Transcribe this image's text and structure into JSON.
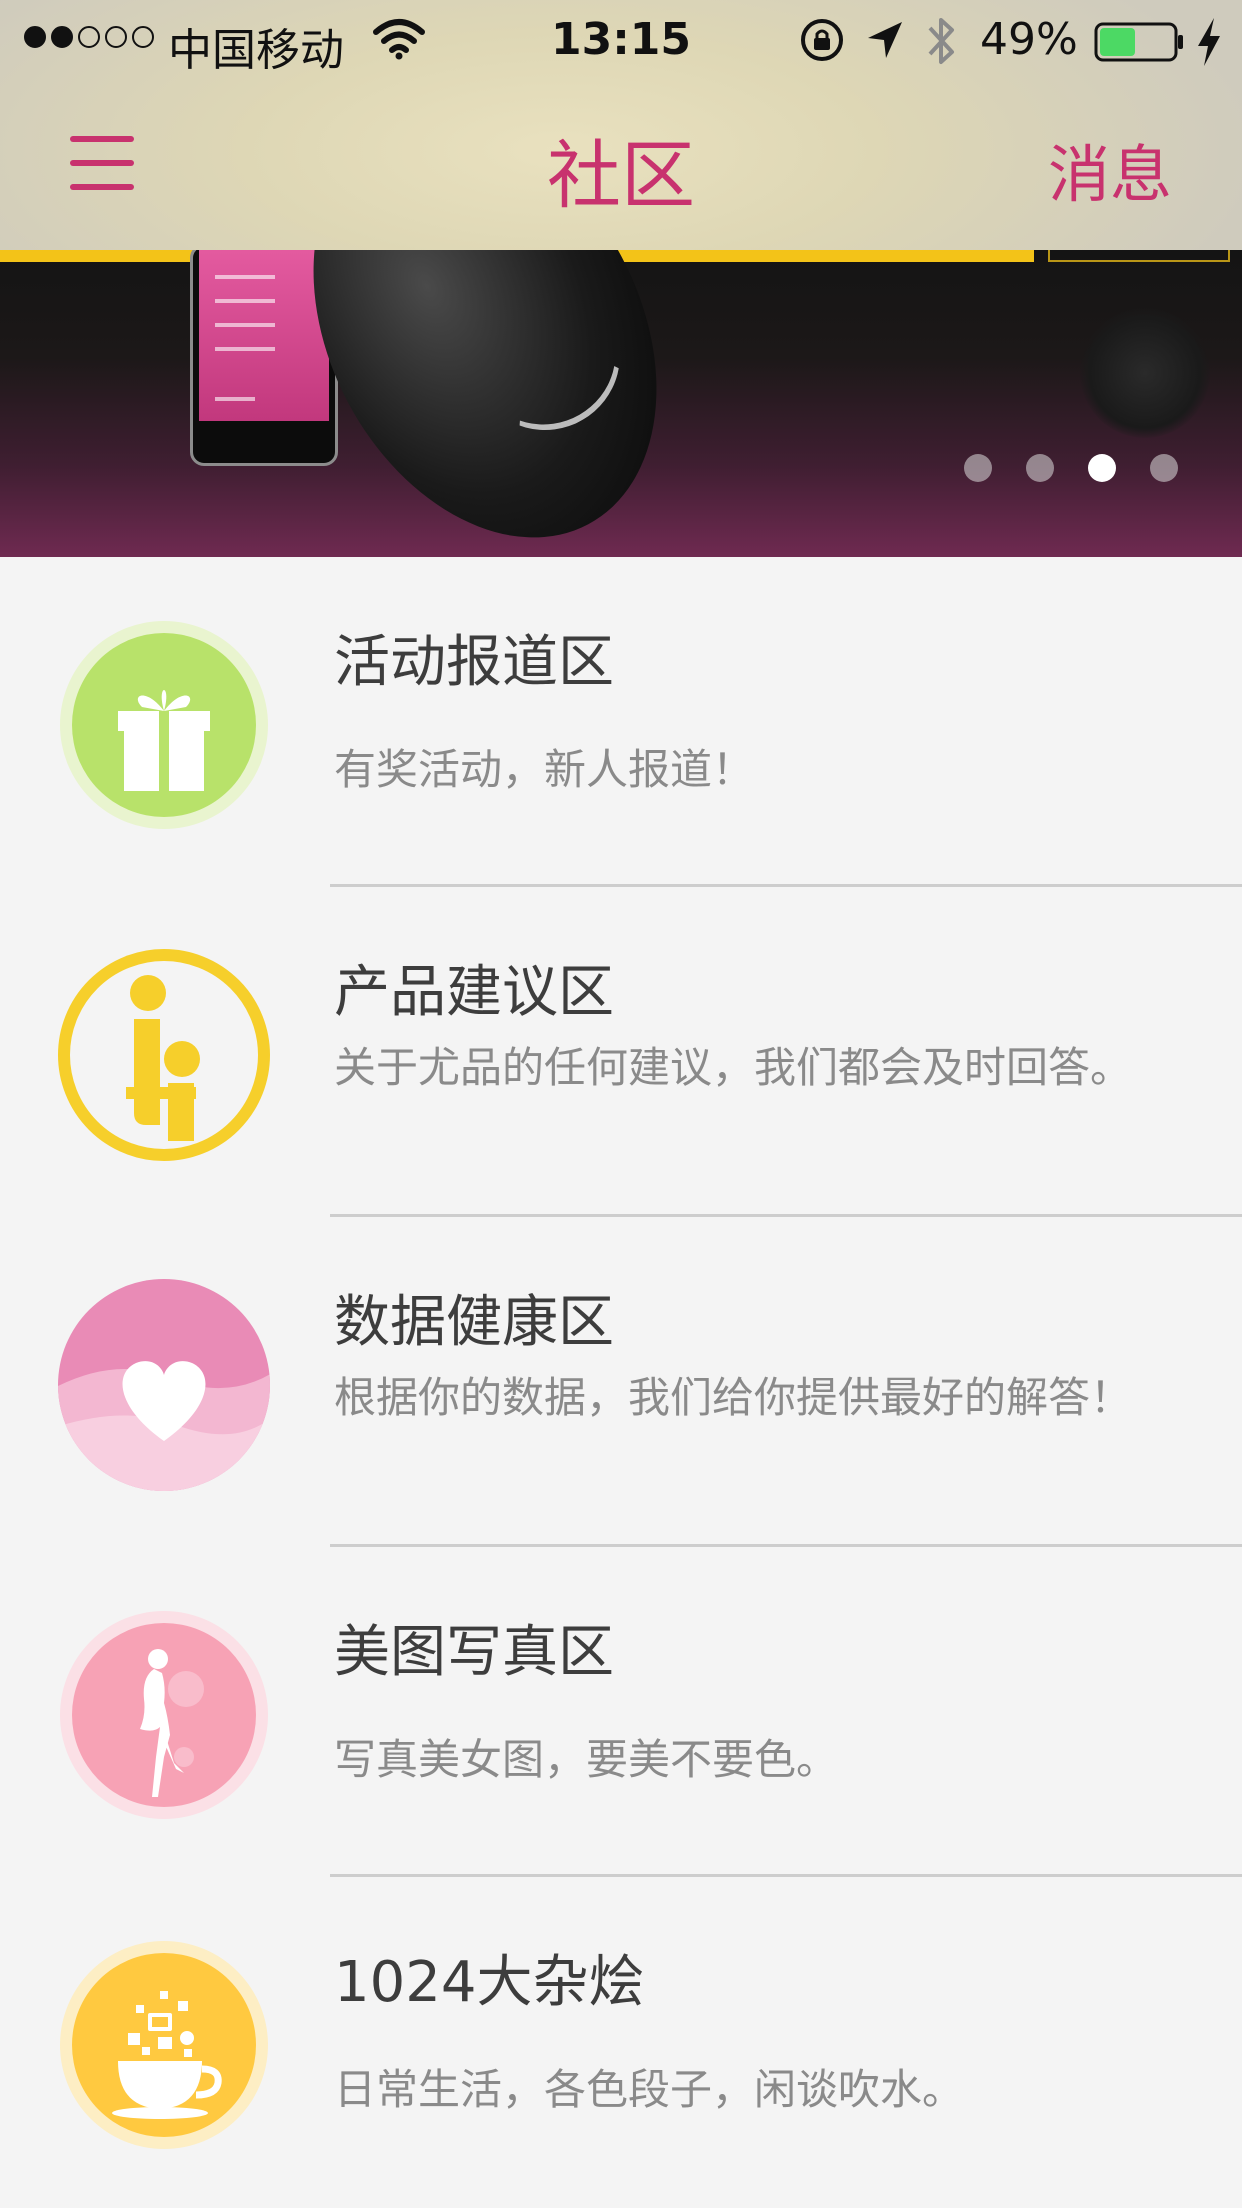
{
  "status_bar": {
    "signal_dots": [
      "full",
      "full",
      "empty",
      "empty",
      "empty"
    ],
    "carrier": "中国移动",
    "time": "13:15",
    "battery_percent": "49%",
    "battery_level": 0.49,
    "battery_color": "#4cd964",
    "icons": [
      "wifi-icon",
      "orientation-lock-icon",
      "location-arrow-icon",
      "bluetooth-icon",
      "battery-icon",
      "charging-bolt-icon"
    ]
  },
  "nav": {
    "menu_icon": "hamburger-menu-icon",
    "title": "社区",
    "messages_label": "消息",
    "accent_color": "#c8326e"
  },
  "banner": {
    "page_count": 4,
    "active_page_index": 2
  },
  "forums": [
    {
      "icon": "gift-icon",
      "title": "活动报道区",
      "description": "有奖活动，新人报道！"
    },
    {
      "icon": "brand-logo-icon",
      "title": "产品建议区",
      "description": "关于尤品的任何建议，我们都会及时回答。"
    },
    {
      "icon": "heart-icon",
      "title": "数据健康区",
      "description": "根据你的数据，我们给你提供最好的解答！"
    },
    {
      "icon": "woman-silhouette-icon",
      "title": "美图写真区",
      "description": "写真美女图，要美不要色。"
    },
    {
      "icon": "teacup-icon",
      "title": "1024大杂烩",
      "description": "日常生活，各色段子，闲谈吹水。"
    }
  ]
}
